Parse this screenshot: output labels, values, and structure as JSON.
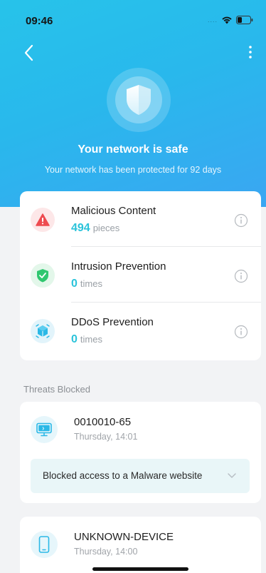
{
  "status_bar": {
    "time": "09:46",
    "signal": "....",
    "icons": [
      "wifi-icon",
      "battery-icon"
    ]
  },
  "nav": {
    "back_icon": "chevron-left-icon",
    "more_icon": "more-vertical-icon"
  },
  "hero": {
    "icon": "shield-icon",
    "title": "Your network is safe",
    "subtitle": "Your network has been protected for 92 days"
  },
  "stats": [
    {
      "label": "Malicious Content",
      "value": "494",
      "unit": "pieces",
      "icon": "warning-triangle-icon",
      "color": "#ee4b50"
    },
    {
      "label": "Intrusion Prevention",
      "value": "0",
      "unit": "times",
      "icon": "shield-check-icon",
      "color": "#2fc76f"
    },
    {
      "label": "DDoS Prevention",
      "value": "0",
      "unit": "times",
      "icon": "cube-icon",
      "color": "#2bb8e6"
    }
  ],
  "threats_section": {
    "label": "Threats Blocked"
  },
  "threats": [
    {
      "device": "0010010-65",
      "time": "Thursday, 14:01",
      "icon": "monitor-icon",
      "detail": "Blocked access to a Malware website"
    },
    {
      "device": "UNKNOWN-DEVICE",
      "time": "Thursday, 14:00",
      "icon": "phone-icon"
    }
  ],
  "colors": {
    "accent": "#2bc3da",
    "hero_start": "#27c3ea",
    "hero_end": "#3aa6f2"
  }
}
